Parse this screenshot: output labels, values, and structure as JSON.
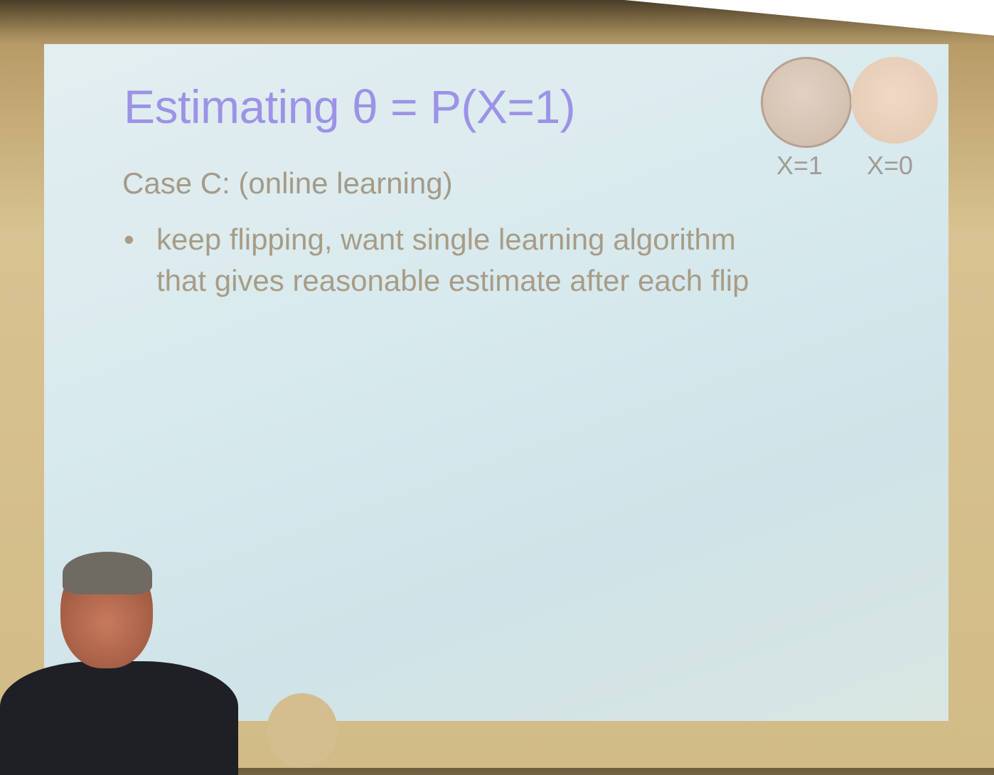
{
  "slide": {
    "title": "Estimating θ = P(X=1)",
    "subtitle": "Case C: (online learning)",
    "bullets": [
      {
        "line1": "keep flipping, want single learning algorithm",
        "line2": "that gives reasonable estimate after each flip"
      }
    ],
    "bullet_symbol": "•",
    "coins": [
      {
        "label": "X=1",
        "icon": "penny-heads-icon"
      },
      {
        "label": "X=0",
        "icon": "penny-tails-icon"
      }
    ]
  },
  "colors": {
    "title": "#9c93e6",
    "text": "#a89c86",
    "screen": "#d8eaee"
  }
}
